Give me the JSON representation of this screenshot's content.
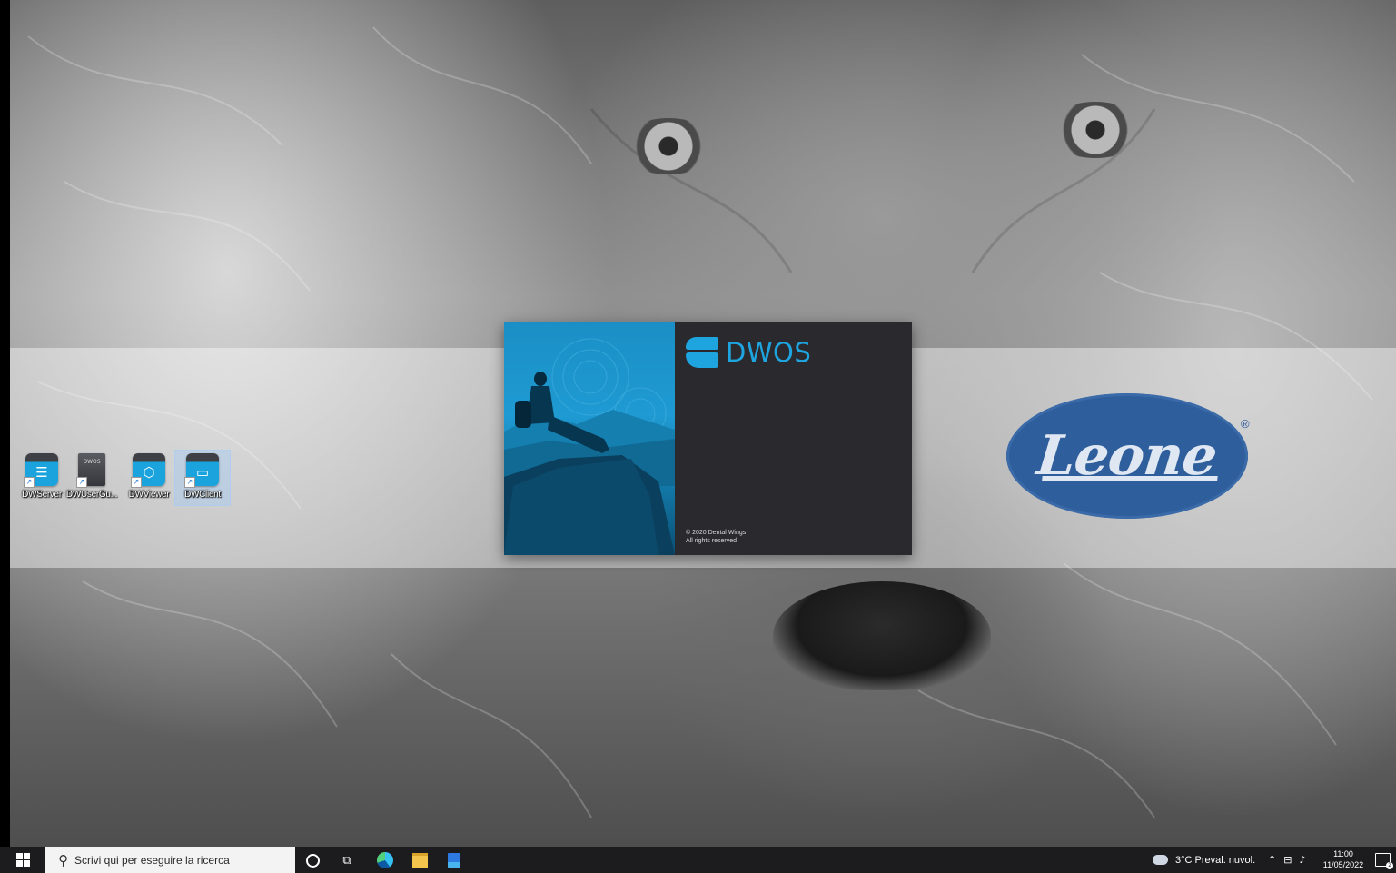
{
  "desktop": {
    "icons": [
      {
        "label": "DWServer",
        "icon": "server-app-icon"
      },
      {
        "label": "DWUserGu...",
        "icon": "document-app-icon",
        "badge": "DWOS"
      },
      {
        "label": "DWViewer",
        "icon": "cube-app-icon"
      },
      {
        "label": "DWClient",
        "icon": "monitor-app-icon",
        "selected": true
      }
    ]
  },
  "splash": {
    "product_name": "DWOS",
    "copyright_line1": "© 2020 Dental Wings",
    "copyright_line2": "All rights reserved"
  },
  "wallpaper": {
    "brand": "Leone",
    "registered_mark": "®"
  },
  "taskbar": {
    "search_placeholder": "Scrivi qui per eseguire la ricerca",
    "pinned": [
      "cortana-circle-icon",
      "task-view-icon",
      "edge-icon",
      "file-explorer-icon",
      "store-icon"
    ],
    "weather_text": "3°C  Preval. nuvol.",
    "time": "11:00",
    "date": "11/05/2022",
    "notification_count": "2",
    "colors": {
      "accent": "#1ea5e0",
      "taskbar": "#1c1c1f"
    }
  }
}
